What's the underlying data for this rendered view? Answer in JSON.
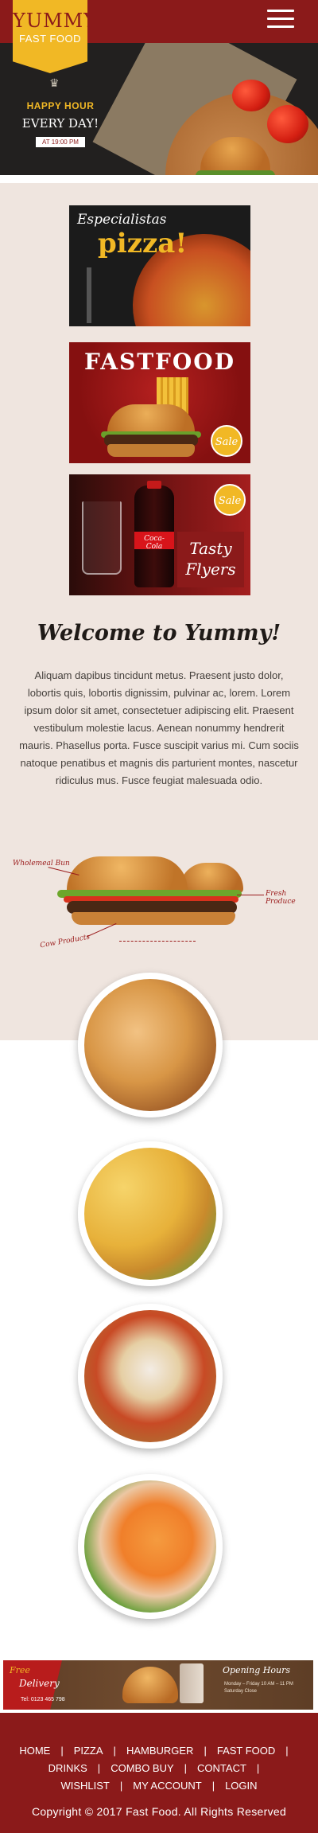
{
  "header": {
    "logo_line1": "YUMMY",
    "logo_line2": "FAST FOOD",
    "menu_icon": "hamburger-menu-icon",
    "brand_color": "#8b1a1a",
    "accent_color": "#f1b825"
  },
  "hero": {
    "happy_hour": "HAPPY HOUR",
    "every_day": "EVERY DAY!",
    "time": "AT 19:00 PM"
  },
  "promos": [
    {
      "title_script": "Especialistas",
      "title_main": "pizza!"
    },
    {
      "title": "FASTFOOD",
      "badge": "Sale"
    },
    {
      "brand": "Coca-Cola",
      "badge": "Sale",
      "title_line1": "Tasty",
      "title_line2": "Flyers"
    }
  ],
  "welcome": {
    "title": "Welcome to Yummy!",
    "text": "Aliquam dapibus tincidunt metus. Praesent justo dolor, lobortis quis, lobortis dignissim, pulvinar ac, lorem. Lorem ipsum dolor sit amet, consectetuer adipiscing elit. Praesent vestibulum molestie lacus. Aenean nonummy hendrerit mauris. Phasellus porta. Fusce suscipit varius mi. Cum sociis natoque penatibus et magnis dis parturient montes, nascetur ridiculus mus. Fusce feugiat malesuada odio."
  },
  "burger_diagram": {
    "label_left": "Wholemeal Bun",
    "label_right": "Fresh Produce",
    "label_bottom": "Cow Products"
  },
  "banner": {
    "free": "Free",
    "delivery": "Delivery",
    "tel": "Tel: 0123 465 798",
    "opening": "Opening Hours",
    "hours_line1": "Monday – Friday  10 AM – 11 PM",
    "hours_line2": "Saturday  Close"
  },
  "footer": {
    "row1": [
      "HOME",
      "PIZZA",
      "HAMBURGER",
      "FAST FOOD"
    ],
    "row2": [
      "DRINKS",
      "COMBO BUY",
      "CONTACT"
    ],
    "row3": [
      "WISHLIST",
      "MY ACCOUNT",
      "LOGIN"
    ],
    "separator": "|",
    "copyright": "Copyright © 2017 Fast Food. All Rights Reserved"
  }
}
